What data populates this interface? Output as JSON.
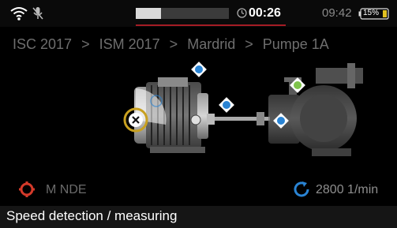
{
  "status_bar": {
    "timer": "00:26",
    "time": "09:42",
    "battery": "15%",
    "wifi_icon": "wifi-icon",
    "mic_icon": "microphone-muted-icon",
    "recording_progress": 0.27
  },
  "breadcrumb": [
    "ISC 2017",
    ">",
    "ISM 2017",
    ">",
    "Mardrid",
    ">",
    "Pumpe 1A"
  ],
  "measurement": {
    "position_label": "M NDE",
    "speed": "2800 1/min"
  },
  "footer": {
    "title": "Speed detection / measuring"
  },
  "colors": {
    "accent_blue": "#2a84d4",
    "accent_green": "#7ec34a",
    "alert_red": "#d43a2a",
    "selection_gold": "#c8a020"
  }
}
